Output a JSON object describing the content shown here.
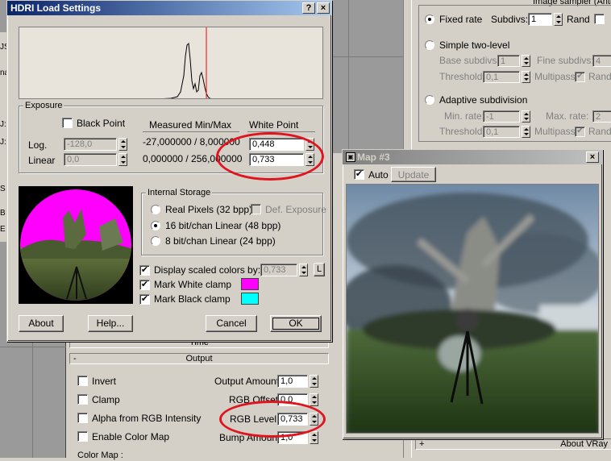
{
  "hdri": {
    "title": "HDRI Load Settings",
    "help_btn": "?",
    "close_btn": "×",
    "exposure": {
      "group_label": "Exposure",
      "black_point_label": "Black Point",
      "measured_label": "Measured Min/Max",
      "white_point_label": "White Point",
      "log_label": "Log.",
      "linear_label": "Linear",
      "black_log_value": "-128,0",
      "black_linear_value": "0,0",
      "measured_log": "-27,000000 / 8,000000",
      "measured_linear": "0,000000 / 256,000000",
      "white_log_value": "0,448",
      "white_linear_value": "0,733"
    },
    "storage": {
      "group_label": "Internal Storage",
      "options": [
        "Real Pixels (32 bpp)",
        "16 bit/chan Linear (48 bpp)",
        "8 bit/chan Linear (24 bpp)"
      ],
      "selected_index": 1,
      "def_exposure_label": "Def. Exposure"
    },
    "display_scaled_label": "Display scaled colors by:",
    "display_scaled_value": "0,733",
    "lock_label": "L",
    "mark_white_label": "Mark White clamp",
    "mark_black_label": "Mark Black clamp",
    "colors": {
      "white_clamp": "#ff00ff",
      "black_clamp": "#00ffff",
      "highlight": "#e0141e"
    },
    "buttons": {
      "about": "About",
      "help": "Help...",
      "cancel": "Cancel",
      "ok": "OK"
    }
  },
  "sampler": {
    "header": "Image sampler (Antia",
    "fixed_rate_label": "Fixed rate",
    "subdivs_label": "Subdivs:",
    "subdivs_value": "1",
    "rand_label": "Rand",
    "simple_two_level_label": "Simple two-level",
    "base_subdivs_label": "Base subdivs:",
    "base_subdivs_value": "1",
    "fine_subdivs_label": "Fine subdivs:",
    "fine_subdivs_value": "4",
    "threshold_label": "Threshold:",
    "threshold_value": "0,1",
    "multipass_label": "Multipass",
    "adaptive_label": "Adaptive subdivision",
    "min_rate_label": "Min. rate:",
    "min_rate_value": "-1",
    "max_rate_label": "Max. rate:",
    "max_rate_value": "2",
    "threshold2_value": "0,1",
    "about_vray": "About VRay"
  },
  "map": {
    "title": "Map #3",
    "close_btn": "×",
    "auto_label": "Auto",
    "update_label": "Update"
  },
  "output": {
    "time_label": "Time",
    "header": "Output",
    "invert_label": "Invert",
    "clamp_label": "Clamp",
    "alpha_label": "Alpha from RGB Intensity",
    "enable_color_map_label": "Enable Color Map",
    "output_amount_label": "Output Amount:",
    "output_amount_value": "1,0",
    "rgb_offset_label": "RGB Offset:",
    "rgb_offset_value": "0,0",
    "rgb_level_label": "RGB Level:",
    "rgb_level_value": "0,733",
    "bump_amount_label": "Bump Amount:",
    "bump_amount_value": "1,0",
    "color_map_label": "Color Map :"
  },
  "left_edge_letters": [
    "JS",
    "na",
    "J:",
    "J:",
    "S",
    "B",
    "E"
  ]
}
